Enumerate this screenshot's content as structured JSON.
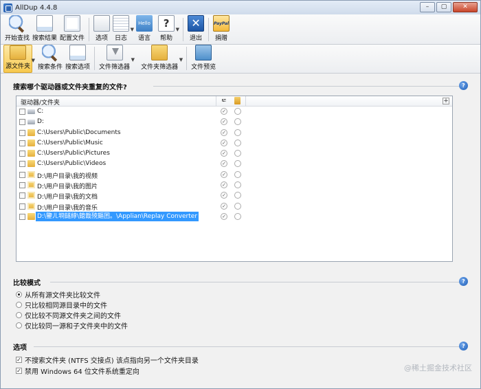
{
  "window": {
    "title": "AllDup 4.4.8"
  },
  "toolbar1": {
    "items": [
      {
        "label": "开始查找",
        "icon": "search-icon"
      },
      {
        "label": "搜索结果",
        "icon": "results-icon"
      },
      {
        "label": "配置文件",
        "icon": "profile-icon"
      },
      {
        "label": "选项",
        "icon": "options-icon"
      },
      {
        "label": "日志",
        "icon": "log-icon"
      },
      {
        "label": "语言",
        "icon": "language-icon",
        "icon_text": "Hello"
      },
      {
        "label": "帮助",
        "icon": "help-icon"
      },
      {
        "label": "退出",
        "icon": "exit-icon"
      },
      {
        "label": "捐赠",
        "icon": "paypal-donate-icon",
        "icon_text": "PayPal"
      }
    ]
  },
  "toolbar2": {
    "items": [
      {
        "label": "源文件夹",
        "icon": "source-folder-icon",
        "active": true
      },
      {
        "label": "搜索条件",
        "icon": "search-criteria-icon"
      },
      {
        "label": "搜索选项",
        "icon": "search-options-icon"
      },
      {
        "label": "文件筛选器",
        "icon": "file-filter-icon"
      },
      {
        "label": "文件夹筛选器",
        "icon": "folder-filter-icon"
      },
      {
        "label": "文件预览",
        "icon": "file-preview-icon"
      }
    ]
  },
  "source_group": {
    "title": "搜索哪个驱动器或文件夹重复的文件?",
    "help": "?",
    "column_header": "驱动器/文件夹",
    "add_column": "+",
    "rows": [
      {
        "label": "C:",
        "icon": "drive"
      },
      {
        "label": "D:",
        "icon": "drive"
      },
      {
        "label": "C:\\Users\\Public\\Documents",
        "icon": "folder"
      },
      {
        "label": "C:\\Users\\Public\\Music",
        "icon": "folder"
      },
      {
        "label": "C:\\Users\\Public\\Pictures",
        "icon": "folder"
      },
      {
        "label": "C:\\Users\\Public\\Videos",
        "icon": "folder"
      },
      {
        "label": "D:\\用户目录\\我的视频",
        "icon": "user"
      },
      {
        "label": "D:\\用户目录\\我的图片",
        "icon": "user"
      },
      {
        "label": "D:\\用户目录\\我的文档",
        "icon": "user"
      },
      {
        "label": "D:\\用户目录\\我的音乐",
        "icon": "user"
      },
      {
        "label": "D:\\鑒ㄦ埛鐩綍\\鎴戠殑鏂囨。\\Applian\\Replay Converter",
        "icon": "folder",
        "selected": true
      }
    ]
  },
  "compare_group": {
    "title": "比较模式",
    "help": "?",
    "options": [
      {
        "label": "从所有源文件夹比较文件",
        "selected": true
      },
      {
        "label": "只比较相同源目录中的文件",
        "selected": false
      },
      {
        "label": "仅比较不同源文件夹之间的文件",
        "selected": false
      },
      {
        "label": "仅比较同一源和子文件夹中的文件",
        "selected": false
      }
    ]
  },
  "options_group": {
    "title": "选项",
    "help": "?",
    "checkboxes": [
      {
        "label": "不搜索文件夹 (NTFS 交接点) 该点指向另一个文件夹目录",
        "checked": true
      },
      {
        "label": "禁用 Windows 64 位文件系统重定向",
        "checked": true
      }
    ]
  },
  "watermark": "@稀土掘金技术社区"
}
